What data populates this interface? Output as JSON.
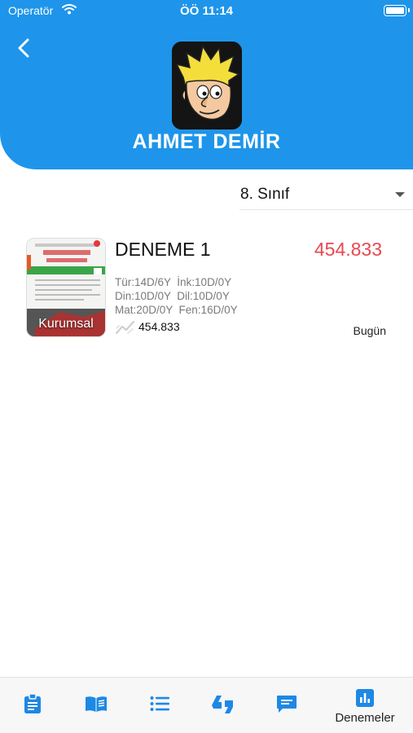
{
  "status_bar": {
    "carrier": "Operatör",
    "time": "ÖÖ 11:14"
  },
  "profile": {
    "name": "AHMET DEMİR"
  },
  "filter": {
    "selected_grade": "8. Sınıf"
  },
  "exams": [
    {
      "thumbnail_label": "Kurumsal",
      "title": "DENEME 1",
      "score": "454.833",
      "details": [
        "Tür:14D/6Y  İnk:10D/0Y",
        "Din:10D/0Y  Dil:10D/0Y",
        "Mat:20D/0Y  Fen:16D/0Y"
      ],
      "net_value": "454.833",
      "date": "Bugün"
    }
  ],
  "tabbar": {
    "active_label": "Denemeler",
    "tabs": [
      "clipboard-icon",
      "book-icon",
      "list-icon",
      "quote-icon",
      "message-icon",
      "chart-icon"
    ]
  },
  "colors": {
    "header": "#1e95ea",
    "score": "#e8474f",
    "accent": "#1e88e5"
  }
}
